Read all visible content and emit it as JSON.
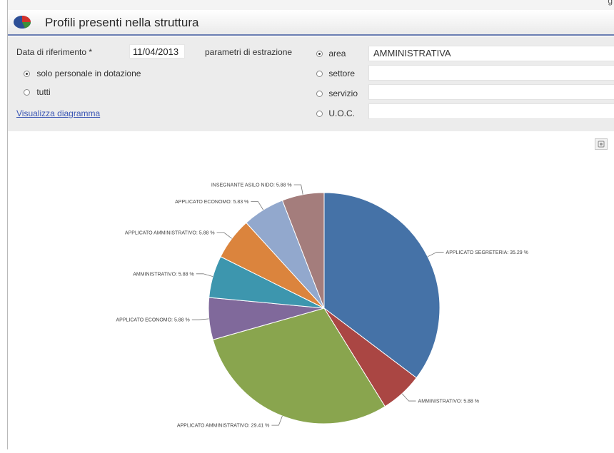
{
  "window": {
    "title": "Profili presenti nella struttura",
    "corner_text": "g"
  },
  "form": {
    "date_label": "Data di riferimento  *",
    "date_value": "11/04/2013",
    "params_label": "parametri di estrazione",
    "scope_options": [
      {
        "label": "solo personale in dotazione",
        "checked": true
      },
      {
        "label": "tutti",
        "checked": false
      }
    ],
    "view_link": "Visualizza diagramma",
    "filters": [
      {
        "label": "area",
        "value": "AMMINISTRATIVA",
        "checked": true
      },
      {
        "label": "settore",
        "value": "",
        "checked": false
      },
      {
        "label": "servizio",
        "value": "",
        "checked": false
      },
      {
        "label": "U.O.C.",
        "value": "",
        "checked": false
      }
    ]
  },
  "chart_data": {
    "type": "pie",
    "slices": [
      {
        "label": "APPLICATO SEGRETERIA: 35.29 %",
        "value": 35.29,
        "color": "#4572a7"
      },
      {
        "label": "AMMINISTRATIVO: 5.88 %",
        "value": 5.88,
        "color": "#aa4643"
      },
      {
        "label": "APPLICATO AMMINISTRATIVO: 29.41 %",
        "value": 29.41,
        "color": "#89a54e"
      },
      {
        "label": "APPLICATO ECONOMO: 5.88 %",
        "value": 5.88,
        "color": "#80699b"
      },
      {
        "label": "AMMINISTRATIVO: 5.88 %",
        "value": 5.88,
        "color": "#3d96ae"
      },
      {
        "label": "APPLICATO AMMINISTRATIVO: 5.88 %",
        "value": 5.88,
        "color": "#db843d"
      },
      {
        "label": "APPLICATO ECONOMO: 5.83 %",
        "value": 5.88,
        "color": "#92a8cd"
      },
      {
        "label": "INSEGNANTE ASILO NIDO: 5.88 %",
        "value": 5.88,
        "color": "#a47d7c"
      }
    ]
  }
}
